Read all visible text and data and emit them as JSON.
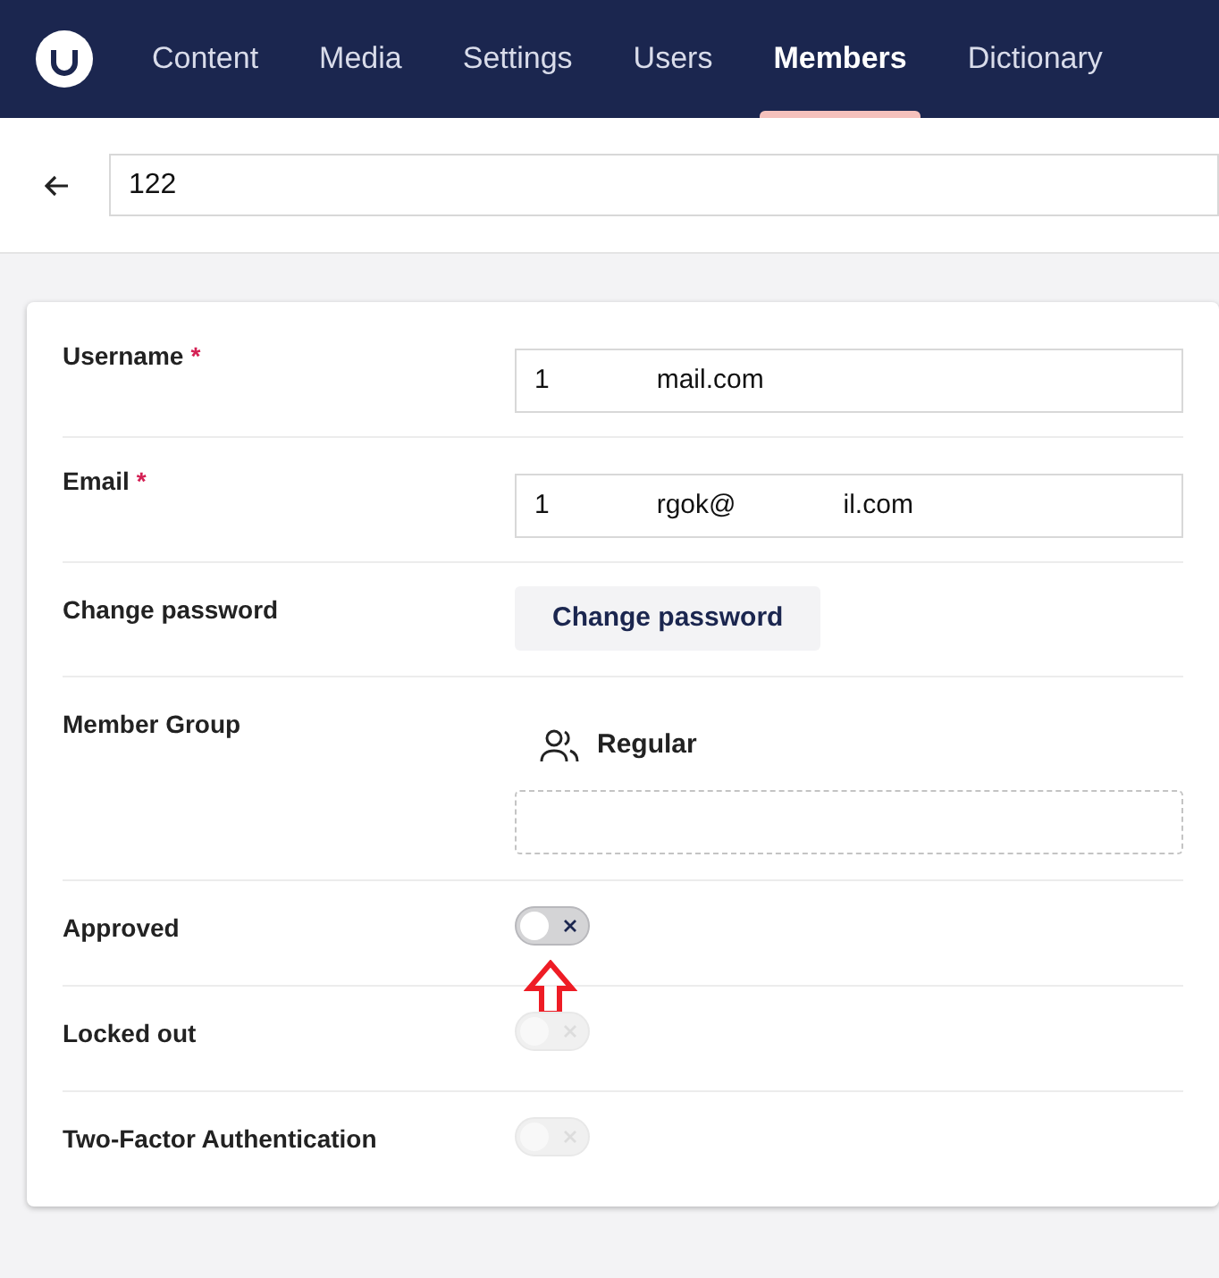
{
  "nav": {
    "tabs": [
      {
        "label": "Content",
        "selected": false
      },
      {
        "label": "Media",
        "selected": false
      },
      {
        "label": "Settings",
        "selected": false
      },
      {
        "label": "Users",
        "selected": false
      },
      {
        "label": "Members",
        "selected": true
      },
      {
        "label": "Dictionary",
        "selected": false
      }
    ]
  },
  "header": {
    "name_value": "122"
  },
  "properties": [
    {
      "kind": "text",
      "label": "Username",
      "required_mark": "*",
      "value_parts": [
        "1",
        "mail.com"
      ]
    },
    {
      "kind": "text",
      "label": "Email",
      "required_mark": "*",
      "value_parts": [
        "1",
        "rgok@",
        "il.com"
      ]
    },
    {
      "kind": "button",
      "label": "Change password",
      "button": "Change password"
    },
    {
      "kind": "groups",
      "label": "Member Group",
      "groups": [
        "Regular"
      ]
    },
    {
      "kind": "toggle",
      "label": "Approved",
      "checked": false,
      "disabled": false
    },
    {
      "kind": "toggle",
      "label": "Locked out",
      "checked": false,
      "disabled": true
    },
    {
      "kind": "toggle",
      "label": "Two-Factor Authentication",
      "checked": false,
      "disabled": true
    }
  ]
}
